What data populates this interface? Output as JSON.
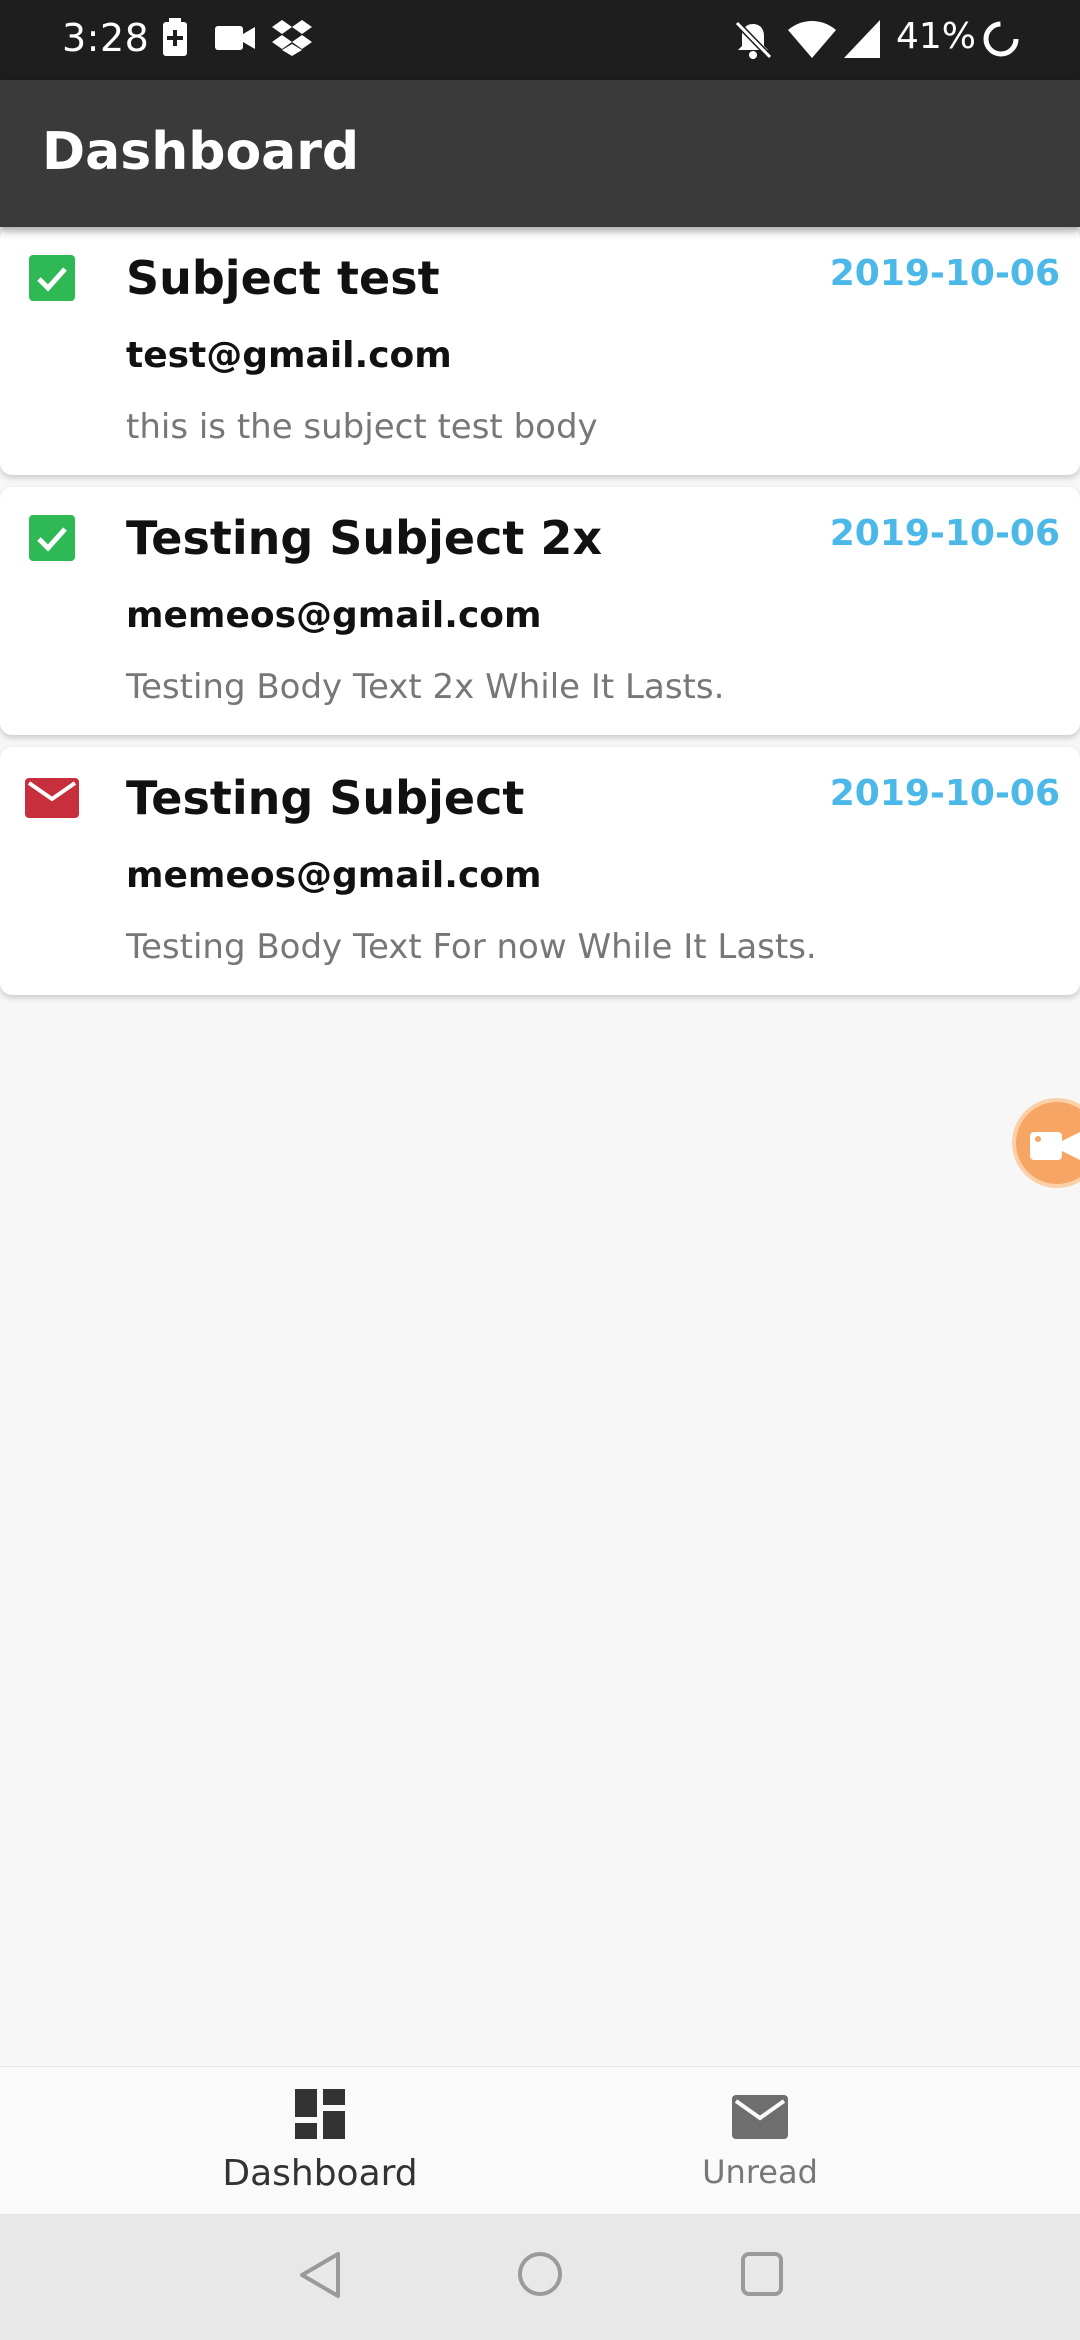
{
  "status_bar": {
    "time": "3:28",
    "battery_percent": "41%",
    "icons": [
      "battery-charging-icon",
      "video-icon",
      "dropbox-icon",
      "notifications-off-icon",
      "wifi-icon",
      "signal-icon",
      "loading-icon"
    ]
  },
  "app_bar": {
    "title": "Dashboard"
  },
  "messages": [
    {
      "subject": "Subject test",
      "email": "test@gmail.com",
      "body": "this is the subject test body",
      "date": "2019-10-06",
      "status_icon": "check-box-icon",
      "status_color": "#2fb954"
    },
    {
      "subject": "Testing Subject 2x",
      "email": "memeos@gmail.com",
      "body": "Testing Body Text 2x While It Lasts.",
      "date": "2019-10-06",
      "status_icon": "check-box-icon",
      "status_color": "#2fb954"
    },
    {
      "subject": "Testing Subject",
      "email": "memeos@gmail.com",
      "body": "Testing Body Text For now While It Lasts.",
      "date": "2019-10-06",
      "status_icon": "mail-icon",
      "status_color": "#c62f3b"
    }
  ],
  "bottom_nav": {
    "items": [
      {
        "label": "Dashboard",
        "icon": "dashboard-icon",
        "active": true
      },
      {
        "label": "Unread",
        "icon": "mail-icon",
        "active": false
      }
    ]
  },
  "colors": {
    "app_bar": "#3a3a3a",
    "status_bar": "#1e1e1e",
    "date_accent": "#4bb8e8",
    "floating_bubble": "#f7a565"
  }
}
